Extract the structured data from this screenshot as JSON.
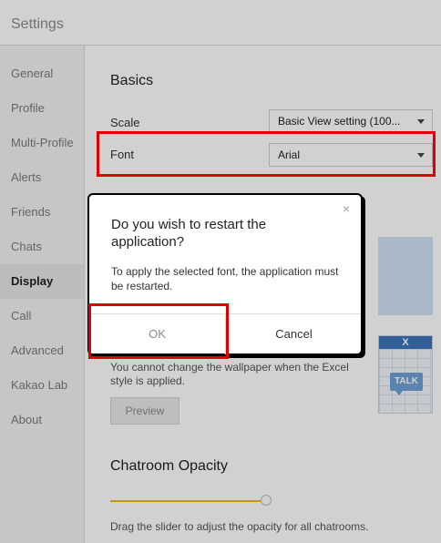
{
  "window": {
    "title": "Settings"
  },
  "sidebar": {
    "items": [
      {
        "label": "General"
      },
      {
        "label": "Profile"
      },
      {
        "label": "Multi-Profile"
      },
      {
        "label": "Alerts"
      },
      {
        "label": "Friends"
      },
      {
        "label": "Chats"
      },
      {
        "label": "Display",
        "active": true
      },
      {
        "label": "Call"
      },
      {
        "label": "Advanced"
      },
      {
        "label": "Kakao Lab"
      },
      {
        "label": "About"
      }
    ]
  },
  "basics": {
    "title": "Basics",
    "scale_label": "Scale",
    "scale_value": "Basic View setting (100...",
    "font_label": "Font",
    "font_value": "Arial"
  },
  "wallpaper": {
    "excel_header": "X",
    "talk_badge": "TALK",
    "note": "You cannot change the wallpaper when the Excel style is applied.",
    "preview_label": "Preview"
  },
  "opacity": {
    "title": "Chatroom Opacity",
    "level_fraction": 1.0,
    "note": "Drag the slider to adjust the opacity for all chatrooms."
  },
  "dialog": {
    "close_glyph": "×",
    "heading": "Do you wish to restart the application?",
    "body": "To apply the selected font, the application must be restarted.",
    "ok_label": "OK",
    "cancel_label": "Cancel"
  },
  "colors": {
    "highlight": "#e00000",
    "slider_accent": "#f2b705",
    "excel_blue": "#3c73b8"
  }
}
